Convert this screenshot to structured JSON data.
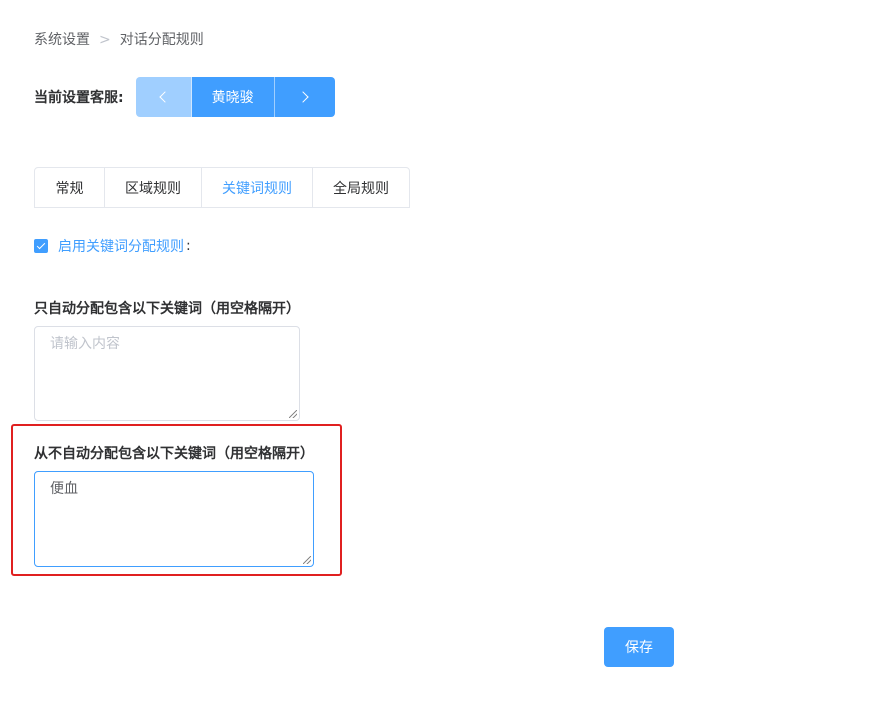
{
  "breadcrumb": {
    "items": [
      "系统设置",
      "对话分配规则"
    ]
  },
  "agent_selector": {
    "label": "当前设置客服:",
    "current_name": "黄晓骏"
  },
  "tabs": [
    {
      "label": "常规",
      "active": false
    },
    {
      "label": "区域规则",
      "active": false
    },
    {
      "label": "关键词规则",
      "active": true
    },
    {
      "label": "全局规则",
      "active": false
    }
  ],
  "keyword_rules": {
    "enable_label": "启用关键词分配规则",
    "enable_colon": ":",
    "enabled": true,
    "include": {
      "title": "只自动分配包含以下关键词（用空格隔开）",
      "placeholder": "请输入内容",
      "value": ""
    },
    "exclude": {
      "title": "从不自动分配包含以下关键词（用空格隔开）",
      "value": "便血"
    }
  },
  "save_label": "保存",
  "colors": {
    "primary": "#409eff",
    "primary_disabled": "#a0cfff",
    "highlight": "#e02020"
  }
}
